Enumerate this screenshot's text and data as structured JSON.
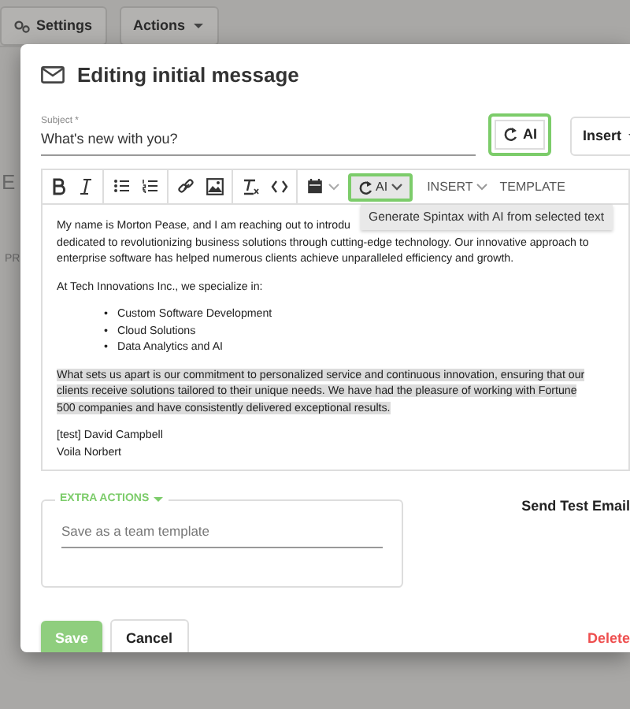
{
  "background_page": {
    "buttons": [
      {
        "label": "Settings"
      },
      {
        "label": "Actions"
      }
    ],
    "fragments": [
      "E",
      "PR"
    ]
  },
  "modal": {
    "title": "Editing initial message",
    "subject": {
      "label": "Subject *",
      "value": "What's new with you?"
    },
    "subject_buttons": [
      {
        "label": "AI",
        "kind": "ai",
        "highlighted": true
      },
      {
        "label": "Insert",
        "kind": "dropdown",
        "highlighted": false
      }
    ],
    "toolbar": [
      {
        "kind": "bold"
      },
      {
        "kind": "italic"
      },
      {
        "kind": "sep"
      },
      {
        "kind": "bullets"
      },
      {
        "kind": "numbers"
      },
      {
        "kind": "sep"
      },
      {
        "kind": "link"
      },
      {
        "kind": "image"
      },
      {
        "kind": "sep"
      },
      {
        "kind": "clear"
      },
      {
        "kind": "code"
      },
      {
        "kind": "sep"
      },
      {
        "kind": "calendar"
      },
      {
        "kind": "ai",
        "label": "AI",
        "highlighted": true
      },
      {
        "kind": "menu",
        "label": "INSERT"
      },
      {
        "kind": "text",
        "label": "TEMPLATE"
      }
    ],
    "tooltip": "Generate Spintax with AI from selected text",
    "body": [
      {
        "kind": "para",
        "highlighted": false,
        "lines": [
          "My name is Morton Pease, and I am reaching out to introdu",
          "dedicated to revolutionizing business solutions through cutting-edge technology. Our innovative approach to",
          "enterprise software has helped numerous clients achieve unparalleled efficiency and growth."
        ]
      },
      {
        "kind": "para",
        "highlighted": false,
        "lines": [
          "At Tech Innovations Inc., we specialize in:"
        ]
      },
      {
        "kind": "list",
        "marker": "•",
        "items": [
          "Custom Software Development",
          "Cloud Solutions",
          "Data Analytics and AI"
        ]
      },
      {
        "kind": "para",
        "highlighted": true,
        "lines": [
          "What sets us apart is our commitment to personalized service and continuous innovation, ensuring that our",
          "clients receive solutions tailored to their unique needs. We have had the pleasure of working with Fortune",
          "500 companies and have consistently delivered exceptional results."
        ]
      },
      {
        "kind": "para",
        "highlighted": false,
        "lines": [
          "[test] David Campbell",
          "Voila Norbert"
        ]
      }
    ],
    "extra_actions": {
      "legend": "EXTRA ACTIONS",
      "placeholder": "Save as a team template"
    },
    "send_test": "Send Test Email",
    "footer": {
      "save": "Save",
      "cancel": "Cancel",
      "delete": "Delete"
    }
  }
}
